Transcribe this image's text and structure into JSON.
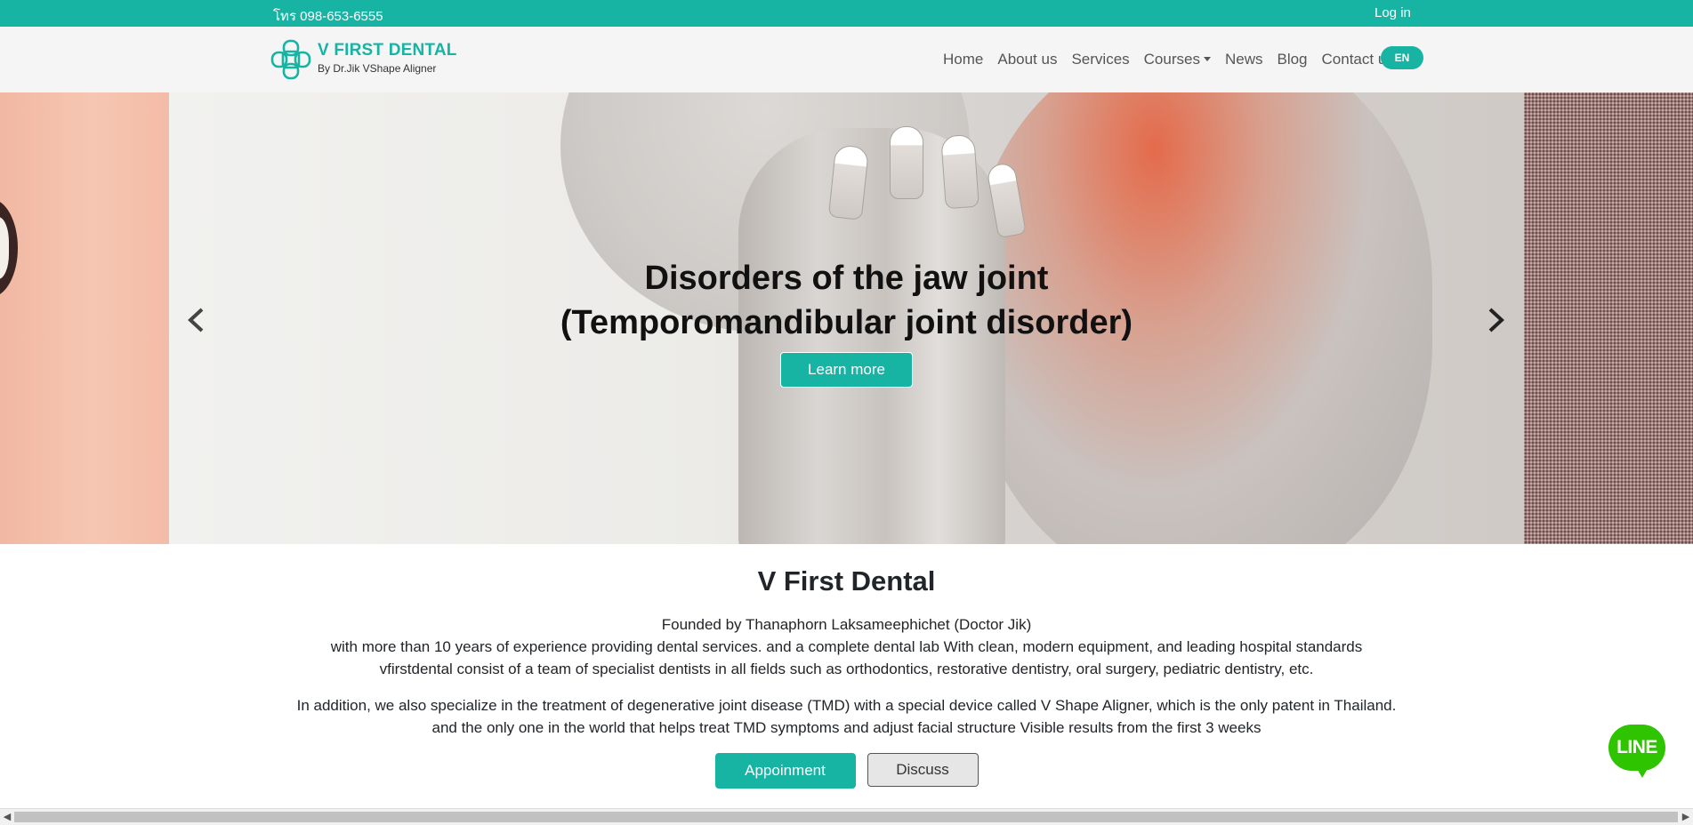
{
  "topbar": {
    "phone": "โทร 098-653-6555",
    "login": "Log in"
  },
  "brand": {
    "name": "V FIRST DENTAL",
    "tagline": "By Dr.Jik VShape Aligner",
    "color": "#17b3a3"
  },
  "nav": {
    "items": [
      "Home",
      "About us",
      "Services",
      "Courses",
      "News",
      "Blog",
      "Contact us"
    ],
    "dropdown_item": "Courses",
    "language": "EN"
  },
  "hero": {
    "title_line1": "Disorders of the jaw joint",
    "title_line2": "(Temporomandibular joint disorder)",
    "cta": "Learn more",
    "prev_icon": "chevron-left-icon",
    "next_icon": "chevron-right-icon"
  },
  "about": {
    "title": "V First Dental",
    "lines": [
      "Founded by Thanaphorn Laksameephichet (Doctor Jik)",
      "with more than 10 years of experience providing dental services. and a complete dental lab With clean, modern equipment, and leading hospital standards",
      "vfirstdental consist of a team of specialist dentists in all fields such as orthodontics, restorative dentistry, oral surgery, pediatric dentistry, etc."
    ],
    "lines2": [
      "In addition, we also specialize in the treatment of degenerative joint disease (TMD) with a special device called V Shape Aligner, which is the only patent in Thailand.",
      "and the only one in the world that helps treat TMD symptoms and adjust facial structure Visible results from the first 3 weeks"
    ],
    "appointment": "Appoinment",
    "discuss": "Discuss"
  },
  "line_chat": {
    "label": "LINE",
    "color": "#2ec400"
  }
}
